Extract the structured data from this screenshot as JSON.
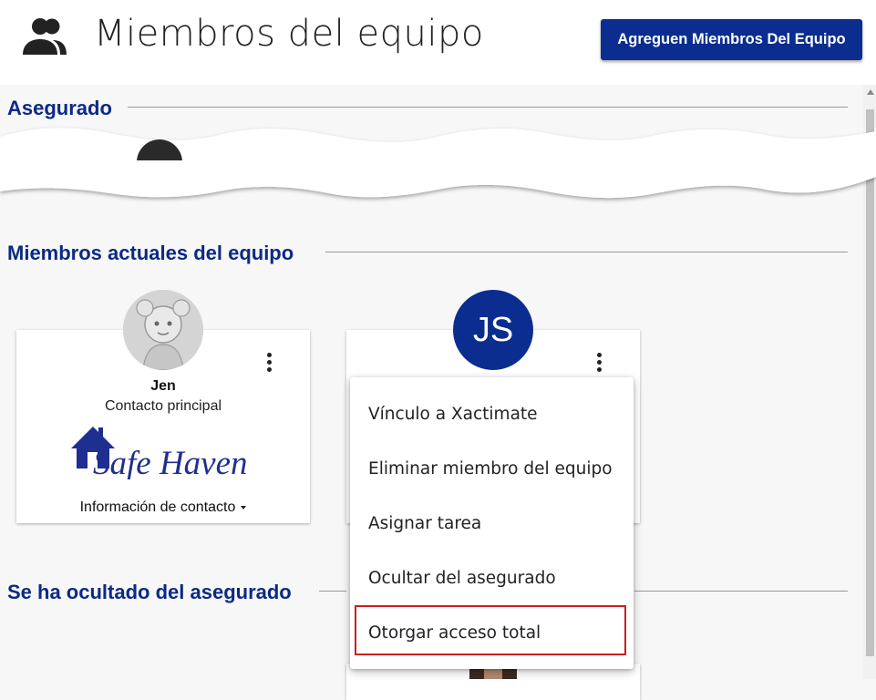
{
  "header": {
    "title": "Miembros del equipo",
    "add_button_label": "Agreguen Miembros Del Equipo",
    "icon": "team-icon"
  },
  "sections": {
    "insured": {
      "title": "Asegurado"
    },
    "current_team": {
      "title": "Miembros actuales del equipo"
    },
    "hidden": {
      "title": "Se ha ocultado del asegurado"
    }
  },
  "members": [
    {
      "name": "Jen",
      "role": "Contacto principal",
      "company_logo_text": "Safe Haven",
      "contact_label": "Información de contacto"
    },
    {
      "initials": "JS"
    }
  ],
  "menu": {
    "items": [
      {
        "label": "Vínculo a Xactimate"
      },
      {
        "label": "Eliminar miembro del equipo"
      },
      {
        "label": "Asignar tarea"
      },
      {
        "label": "Ocultar del asegurado"
      },
      {
        "label": "Otorgar acceso total",
        "highlighted": true
      }
    ]
  },
  "colors": {
    "primary": "#0a2d8f",
    "section_title": "#0b2a84",
    "highlight_border": "#cc1f1f"
  }
}
